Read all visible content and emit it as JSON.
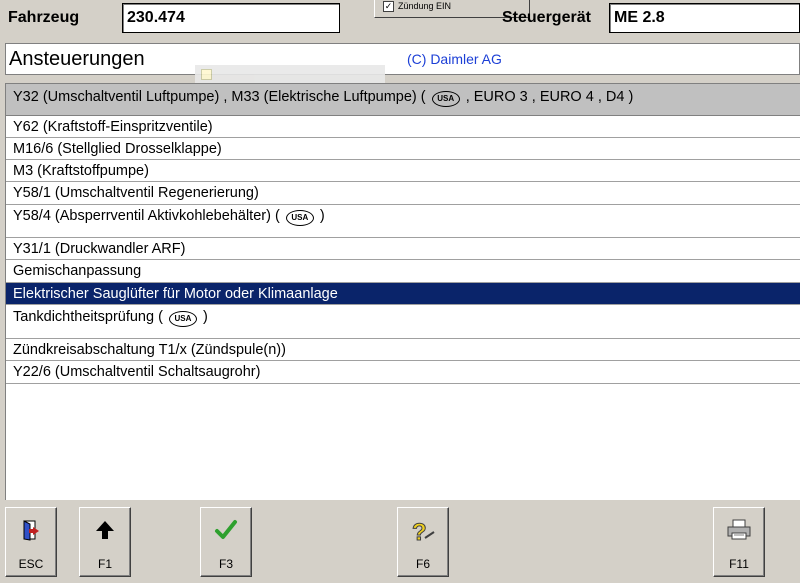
{
  "header": {
    "vehicle_label": "Fahrzeug",
    "vehicle_value": "230.474",
    "ecu_label": "Steuergerät",
    "ecu_value": "ME 2.8",
    "ignition_text": "Zündung EIN",
    "ignition_checked": true
  },
  "title": {
    "text": "Ansteuerungen",
    "copyright": "(C) Daimler AG"
  },
  "list": {
    "header_row": {
      "text_before": "Y32 (Umschaltventil Luftpumpe) , M33 (Elektrische Luftpumpe) (",
      "badge": "USA",
      "text_after": ", EURO 3 , EURO 4 , D4 )"
    },
    "items": [
      {
        "text": "Y62 (Kraftstoff-Einspritzventile)"
      },
      {
        "text": "M16/6 (Stellglied Drosselklappe)"
      },
      {
        "text": "M3 (Kraftstoffpumpe)"
      },
      {
        "text": "Y58/1 (Umschaltventil Regenerierung)"
      },
      {
        "text_before": "Y58/4 (Absperrventil Aktivkohlebehälter) (",
        "badge": "USA",
        "text_after": ")"
      },
      {
        "text": "Y31/1 (Druckwandler ARF)"
      },
      {
        "text": "Gemischanpassung"
      },
      {
        "text": "Elektrischer Sauglüfter für Motor oder Klimaanlage",
        "selected": true
      },
      {
        "text_before": "Tankdichtheitsprüfung (",
        "badge": "USA",
        "text_after": ")"
      },
      {
        "text": "Zündkreisabschaltung T1/x (Zündspule(n))"
      },
      {
        "text": "Y22/6 (Umschaltventil Schaltsaugrohr)"
      }
    ]
  },
  "buttons": {
    "esc": {
      "label": "ESC",
      "icon": "exit-door-icon"
    },
    "f1": {
      "label": "F1",
      "icon": "arrow-up-icon"
    },
    "f3": {
      "label": "F3",
      "icon": "checkmark-icon"
    },
    "f6": {
      "label": "F6",
      "icon": "help-question-icon"
    },
    "f11": {
      "label": "F11",
      "icon": "printer-icon"
    }
  },
  "colors": {
    "selection": "#0a246a",
    "header_row": "#c0c0c0",
    "copyright": "#1c3fd6",
    "check_green": "#2ea02e",
    "question_yellow": "#f0d020"
  }
}
